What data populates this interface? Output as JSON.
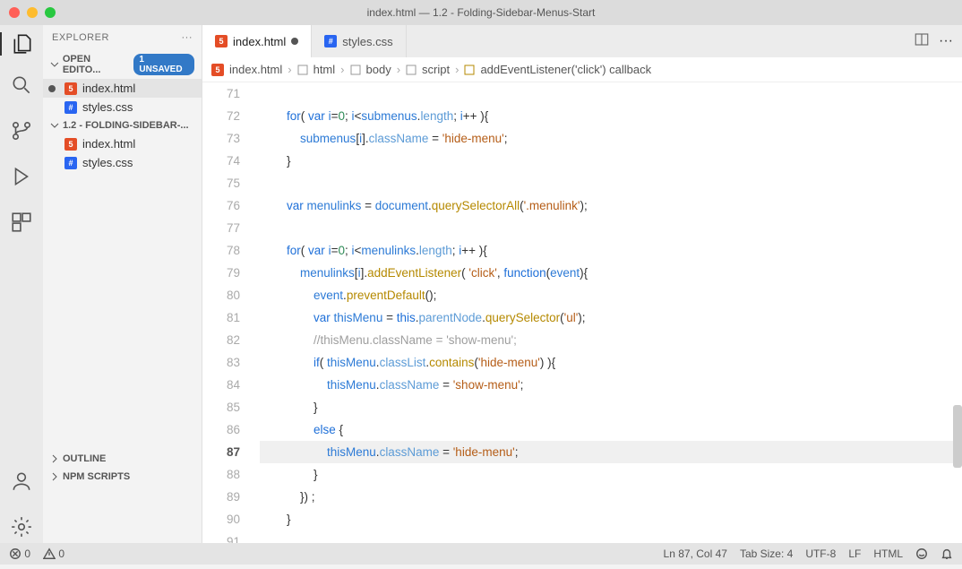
{
  "window": {
    "title": "index.html — 1.2 - Folding-Sidebar-Menus-Start"
  },
  "explorer": {
    "title": "EXPLORER",
    "openEditors": {
      "label": "OPEN EDITO...",
      "badge": "1 UNSAVED"
    },
    "folder": {
      "label": "1.2 - FOLDING-SIDEBAR-..."
    },
    "outline": "OUTLINE",
    "npm": "NPM SCRIPTS",
    "files": {
      "indexhtml": "index.html",
      "stylescss": "styles.css"
    }
  },
  "tabs": {
    "t1": "index.html",
    "t2": "styles.css"
  },
  "breadcrumbs": {
    "b0": "index.html",
    "b1": "html",
    "b2": "body",
    "b3": "script",
    "b4": "addEventListener('click') callback"
  },
  "code": {
    "lines": [
      71,
      72,
      73,
      74,
      75,
      76,
      77,
      78,
      79,
      80,
      81,
      82,
      83,
      84,
      85,
      86,
      87,
      88,
      89,
      90,
      91
    ]
  },
  "status": {
    "errors": "0",
    "warnings": "0",
    "cursor": "Ln 87, Col 47",
    "tab": "Tab Size: 4",
    "enc": "UTF-8",
    "eol": "LF",
    "lang": "HTML"
  }
}
